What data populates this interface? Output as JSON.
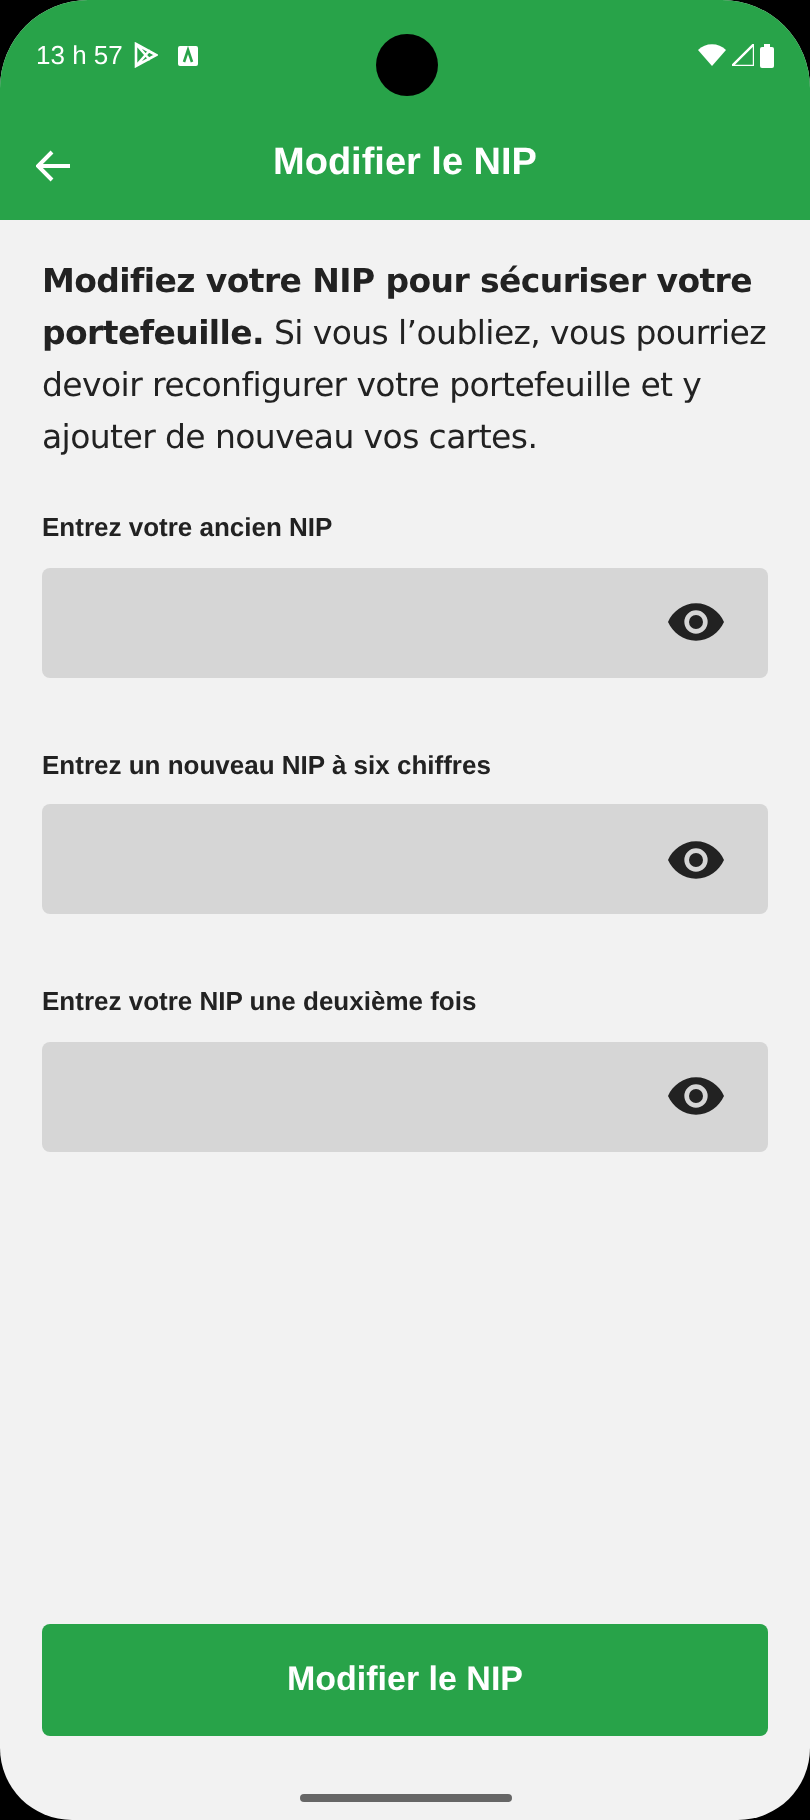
{
  "status_bar": {
    "time": "13 h 57"
  },
  "app_bar": {
    "title": "Modifier le NIP"
  },
  "intro": "**Modifiez votre NIP pour sécuriser votre portefeuille.** Si vous l’oubliez, vous pourriez devoir reconfigurer votre portefeuille et y ajouter de nouveau vos cartes.",
  "fields": [
    {
      "label": "Entrez votre ancien NIP"
    },
    {
      "label": "Entrez un nouveau NIP à six chiffres"
    },
    {
      "label": "Entrez votre NIP une deuxième fois"
    }
  ],
  "submit_button": "Modifier le NIP"
}
